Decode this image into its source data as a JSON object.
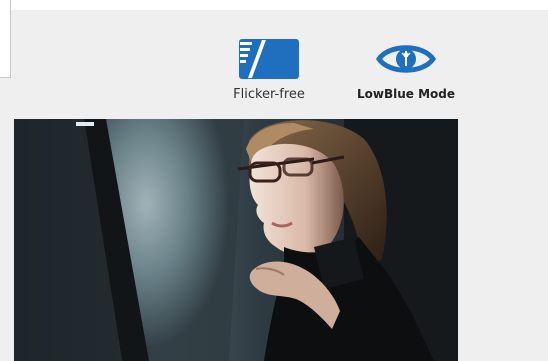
{
  "features": [
    {
      "label": "Flicker-free",
      "icon": "flicker-free-icon",
      "color": "#1f6fbf"
    },
    {
      "label": "LowBlue Mode",
      "icon": "eye-icon",
      "color": "#1f6fbf"
    }
  ],
  "photo": {
    "subject": "woman-at-screen-image"
  }
}
